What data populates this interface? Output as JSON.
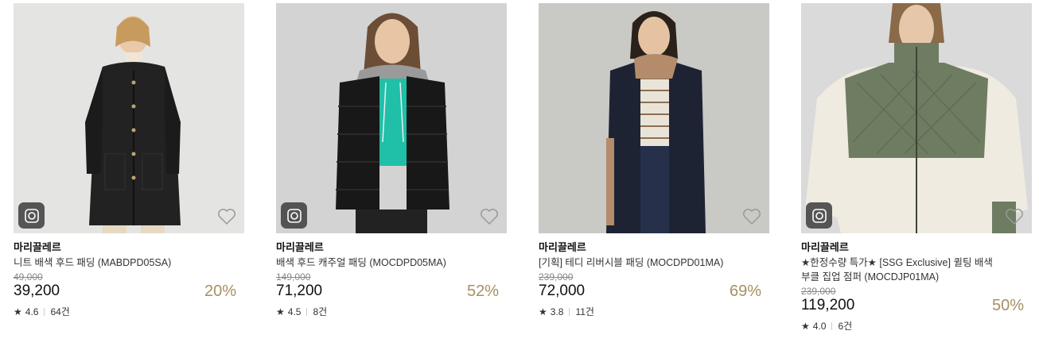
{
  "products": [
    {
      "brand": "마리끌레르",
      "name": "니트 배색 후드 패딩 (MABDPD05SA)",
      "original_price": "49,000",
      "price": "39,200",
      "discount": "20%",
      "rating": "4.6",
      "reviews": "64건",
      "image": {
        "bg": "#dcdcdc",
        "coat": "#1f1f1f",
        "accent": "#e8dcc8",
        "style": "long-black-quilted-coat"
      }
    },
    {
      "brand": "마리끌레르",
      "name": "배색 후드 캐주얼 패딩 (MOCDPD05MA)",
      "original_price": "149,000",
      "price": "71,200",
      "discount": "52%",
      "rating": "4.5",
      "reviews": "8건",
      "image": {
        "bg": "#d3d3d3",
        "coat": "#161616",
        "accent": "#1dbfa9",
        "style": "short-black-puffer-hoodie"
      }
    },
    {
      "brand": "마리끌레르",
      "name": "[기획] 테디 리버시블 패딩 (MOCDPD01MA)",
      "original_price": "239,000",
      "price": "72,000",
      "discount": "69%",
      "rating": "3.8",
      "reviews": "11건",
      "image": {
        "bg": "#c8c8c4",
        "coat": "#1d2233",
        "accent": "#b48c6c",
        "style": "navy-teddy-coat"
      }
    },
    {
      "brand": "마리끌레르",
      "name": "★한정수량 특가★ [SSG Exclusive] 퀼팅 배색 부클 집업 점퍼 (MOCDJP01MA)",
      "original_price": "239,000",
      "price": "119,200",
      "discount": "50%",
      "rating": "4.0",
      "reviews": "6건",
      "image": {
        "bg": "#d9d9d9",
        "coat": "#f0ebe0",
        "accent": "#6e7c62",
        "style": "boucle-zipup-jacket"
      }
    }
  ],
  "icons": {
    "badge": "instagram-camera-icon",
    "wishlist": "heart-outline-icon",
    "star": "★"
  }
}
